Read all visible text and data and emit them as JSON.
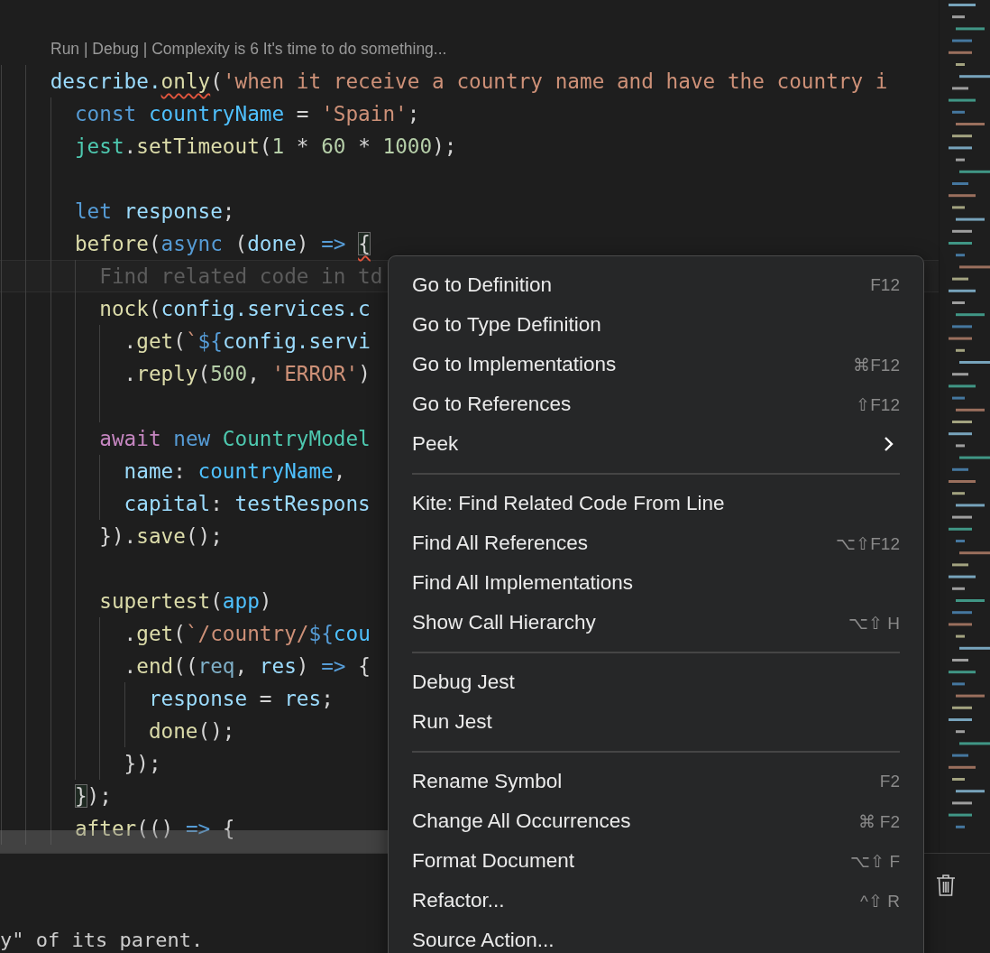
{
  "editor": {
    "codelens": "Run | Debug | Complexity is 6 It's time to do something...",
    "lines": [
      {
        "kind": "code",
        "tokens": [
          {
            "text": "describe.",
            "kind": "var"
          },
          {
            "text": "only",
            "kind": "fn_squiggle"
          },
          {
            "text": "(",
            "kind": "punc"
          },
          {
            "text": "'when it receive a country name and have the country i",
            "kind": "str"
          }
        ],
        "children": [
          {
            "kind": "code",
            "tokens": [
              {
                "text": "const ",
                "kind": "kw"
              },
              {
                "text": "countryName",
                "kind": "const"
              },
              {
                "text": " = ",
                "kind": "punc"
              },
              {
                "text": "'Spain'",
                "kind": "str"
              },
              {
                "text": ";",
                "kind": "punc"
              }
            ]
          },
          {
            "kind": "code",
            "tokens": [
              {
                "text": "jest",
                "kind": "cls"
              },
              {
                "text": ".",
                "kind": "punc"
              },
              {
                "text": "setTimeout",
                "kind": "fn"
              },
              {
                "text": "(",
                "kind": "punc"
              },
              {
                "text": "1",
                "kind": "num"
              },
              {
                "text": " * ",
                "kind": "punc"
              },
              {
                "text": "60",
                "kind": "num"
              },
              {
                "text": " * ",
                "kind": "punc"
              },
              {
                "text": "1000",
                "kind": "num"
              },
              {
                "text": ");",
                "kind": "punc"
              }
            ]
          },
          {
            "kind": "blank"
          },
          {
            "kind": "code",
            "tokens": [
              {
                "text": "let ",
                "kind": "kw"
              },
              {
                "text": "response",
                "kind": "var"
              },
              {
                "text": ";",
                "kind": "punc"
              }
            ]
          },
          {
            "kind": "code",
            "tokens": [
              {
                "text": "before",
                "kind": "fn"
              },
              {
                "text": "(",
                "kind": "punc"
              },
              {
                "text": "async",
                "kind": "kw"
              },
              {
                "text": " (",
                "kind": "punc"
              },
              {
                "text": "done",
                "kind": "var"
              },
              {
                "text": ") ",
                "kind": "punc"
              },
              {
                "text": "=> ",
                "kind": "kw"
              },
              {
                "text": "{",
                "kind": "bracket_squiggle"
              }
            ],
            "children": [
              {
                "kind": "ghost",
                "text": "Find related code in td"
              },
              {
                "kind": "code",
                "tokens": [
                  {
                    "text": "nock",
                    "kind": "fn"
                  },
                  {
                    "text": "(",
                    "kind": "punc"
                  },
                  {
                    "text": "config.services.c",
                    "kind": "var"
                  }
                ],
                "children": [
                  {
                    "kind": "code",
                    "tokens": [
                      {
                        "text": ".",
                        "kind": "punc"
                      },
                      {
                        "text": "get",
                        "kind": "fn"
                      },
                      {
                        "text": "(",
                        "kind": "punc"
                      },
                      {
                        "text": "`",
                        "kind": "str"
                      },
                      {
                        "text": "${",
                        "kind": "kw"
                      },
                      {
                        "text": "config.servi",
                        "kind": "var"
                      }
                    ]
                  },
                  {
                    "kind": "code",
                    "tokens": [
                      {
                        "text": ".",
                        "kind": "punc"
                      },
                      {
                        "text": "reply",
                        "kind": "fn"
                      },
                      {
                        "text": "(",
                        "kind": "punc"
                      },
                      {
                        "text": "500",
                        "kind": "num"
                      },
                      {
                        "text": ", ",
                        "kind": "punc"
                      },
                      {
                        "text": "'ERROR'",
                        "kind": "str"
                      },
                      {
                        "text": ")",
                        "kind": "punc"
                      }
                    ]
                  },
                  {
                    "kind": "blank"
                  }
                ]
              },
              {
                "kind": "code",
                "tokens": [
                  {
                    "text": "await ",
                    "kind": "ctrl"
                  },
                  {
                    "text": "new ",
                    "kind": "kw"
                  },
                  {
                    "text": "CountryModel",
                    "kind": "cls"
                  }
                ],
                "children": [
                  {
                    "kind": "code",
                    "tokens": [
                      {
                        "text": "name",
                        "kind": "var"
                      },
                      {
                        "text": ": ",
                        "kind": "punc"
                      },
                      {
                        "text": "countryName",
                        "kind": "const"
                      },
                      {
                        "text": ",",
                        "kind": "punc"
                      }
                    ]
                  },
                  {
                    "kind": "code",
                    "tokens": [
                      {
                        "text": "capital",
                        "kind": "var"
                      },
                      {
                        "text": ": ",
                        "kind": "punc"
                      },
                      {
                        "text": "testRespons",
                        "kind": "var"
                      }
                    ]
                  }
                ]
              },
              {
                "kind": "code",
                "tokens": [
                  {
                    "text": "}).",
                    "kind": "punc"
                  },
                  {
                    "text": "save",
                    "kind": "fn"
                  },
                  {
                    "text": "();",
                    "kind": "punc"
                  }
                ]
              },
              {
                "kind": "blank"
              },
              {
                "kind": "code",
                "tokens": [
                  {
                    "text": "supertest",
                    "kind": "fn"
                  },
                  {
                    "text": "(",
                    "kind": "punc"
                  },
                  {
                    "text": "app",
                    "kind": "const"
                  },
                  {
                    "text": ")",
                    "kind": "punc"
                  }
                ],
                "children": [
                  {
                    "kind": "code",
                    "tokens": [
                      {
                        "text": ".",
                        "kind": "punc"
                      },
                      {
                        "text": "get",
                        "kind": "fn"
                      },
                      {
                        "text": "(",
                        "kind": "punc"
                      },
                      {
                        "text": "`/country/",
                        "kind": "str"
                      },
                      {
                        "text": "${",
                        "kind": "kw"
                      },
                      {
                        "text": "cou",
                        "kind": "const"
                      }
                    ]
                  },
                  {
                    "kind": "code",
                    "tokens": [
                      {
                        "text": ".",
                        "kind": "punc"
                      },
                      {
                        "text": "end",
                        "kind": "fn"
                      },
                      {
                        "text": "((",
                        "kind": "punc"
                      },
                      {
                        "text": "req",
                        "kind": "param"
                      },
                      {
                        "text": ", ",
                        "kind": "punc"
                      },
                      {
                        "text": "res",
                        "kind": "var"
                      },
                      {
                        "text": ") ",
                        "kind": "punc"
                      },
                      {
                        "text": "=>",
                        "kind": "kw"
                      },
                      {
                        "text": " {",
                        "kind": "punc"
                      }
                    ],
                    "children": [
                      {
                        "kind": "code",
                        "tokens": [
                          {
                            "text": "response",
                            "kind": "var"
                          },
                          {
                            "text": " = ",
                            "kind": "punc"
                          },
                          {
                            "text": "res",
                            "kind": "var"
                          },
                          {
                            "text": ";",
                            "kind": "punc"
                          }
                        ]
                      },
                      {
                        "kind": "code",
                        "tokens": [
                          {
                            "text": "done",
                            "kind": "fn"
                          },
                          {
                            "text": "();",
                            "kind": "punc"
                          }
                        ]
                      }
                    ]
                  },
                  {
                    "kind": "code",
                    "tokens": [
                      {
                        "text": "});",
                        "kind": "punc"
                      }
                    ]
                  }
                ]
              }
            ]
          },
          {
            "kind": "code",
            "tokens": [
              {
                "text": "}",
                "kind": "bracket"
              },
              {
                "text": ");",
                "kind": "punc"
              }
            ]
          },
          {
            "kind": "code",
            "tokens": [
              {
                "text": "after",
                "kind": "fn"
              },
              {
                "text": "(() ",
                "kind": "punc"
              },
              {
                "text": "=>",
                "kind": "kw"
              },
              {
                "text": " {",
                "kind": "punc"
              }
            ]
          }
        ]
      }
    ]
  },
  "panel": {
    "text": "y\" of its parent."
  },
  "context_menu": {
    "items": [
      {
        "kind": "item",
        "label": "Go to Definition",
        "shortcut": "F12"
      },
      {
        "kind": "item",
        "label": "Go to Type Definition"
      },
      {
        "kind": "item",
        "label": "Go to Implementations",
        "shortcut": "⌘F12"
      },
      {
        "kind": "item",
        "label": "Go to References",
        "shortcut": "⇧F12"
      },
      {
        "kind": "submenu",
        "label": "Peek"
      },
      {
        "kind": "separator"
      },
      {
        "kind": "item",
        "label": "Kite: Find Related Code From Line"
      },
      {
        "kind": "item",
        "label": "Find All References",
        "shortcut": "⌥⇧F12"
      },
      {
        "kind": "item",
        "label": "Find All Implementations"
      },
      {
        "kind": "item",
        "label": "Show Call Hierarchy",
        "shortcut": "⌥⇧ H"
      },
      {
        "kind": "separator"
      },
      {
        "kind": "item",
        "label": "Debug Jest"
      },
      {
        "kind": "item",
        "label": "Run Jest"
      },
      {
        "kind": "separator"
      },
      {
        "kind": "item",
        "label": "Rename Symbol",
        "shortcut": "F2"
      },
      {
        "kind": "item",
        "label": "Change All Occurrences",
        "shortcut": "⌘ F2"
      },
      {
        "kind": "item",
        "label": "Format Document",
        "shortcut": "⌥⇧ F"
      },
      {
        "kind": "item",
        "label": "Refactor...",
        "shortcut": "^⇧ R"
      },
      {
        "kind": "item",
        "label": "Source Action..."
      }
    ]
  }
}
